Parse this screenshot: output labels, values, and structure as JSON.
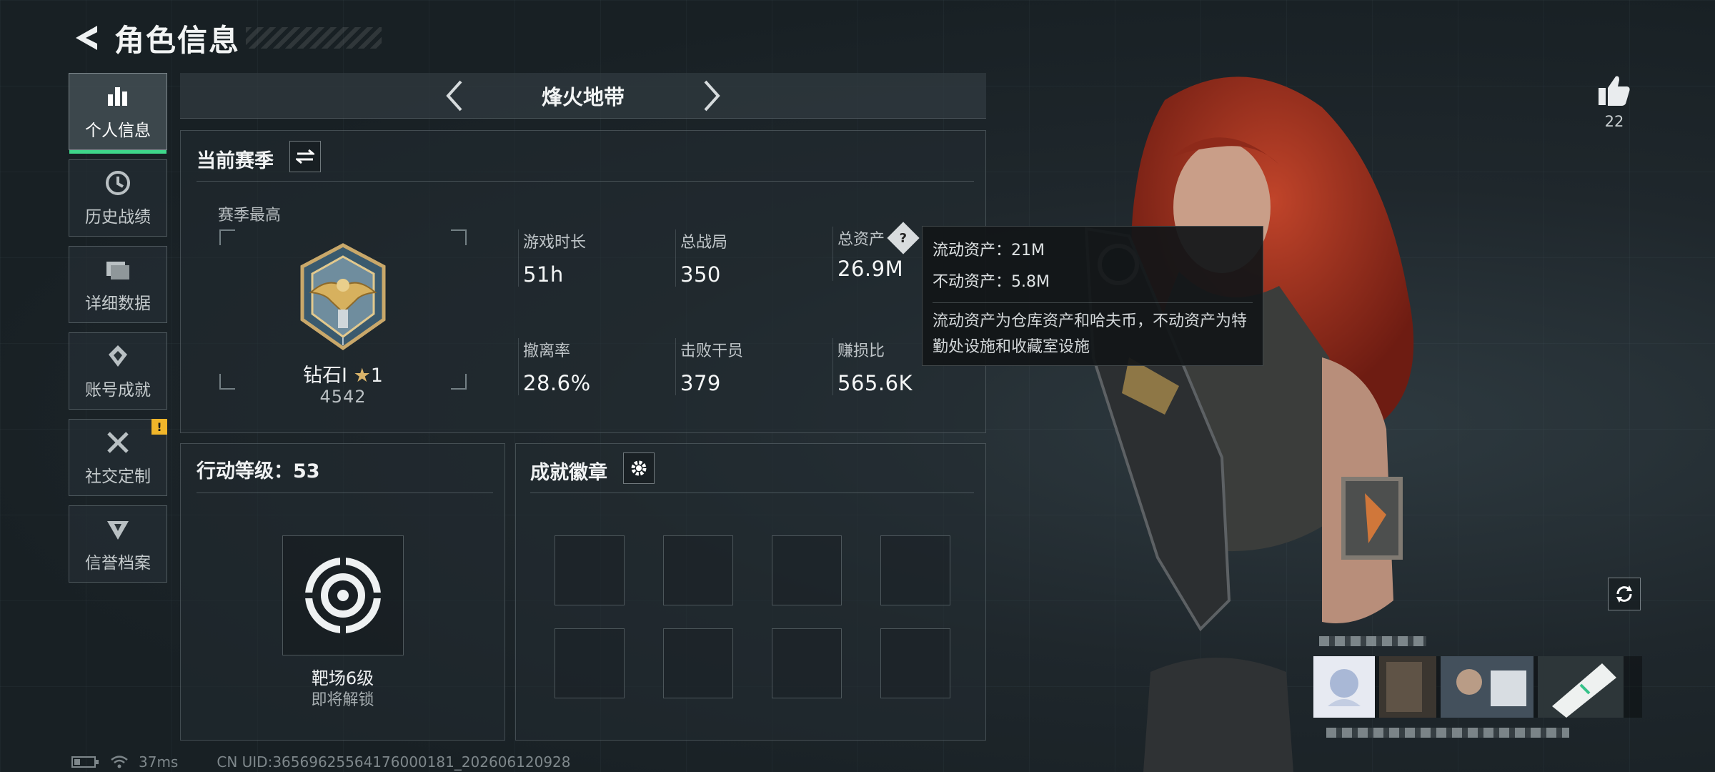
{
  "header": {
    "title": "角色信息"
  },
  "sidebar": {
    "items": [
      {
        "label": "个人信息",
        "icon": "bar-chart-icon"
      },
      {
        "label": "历史战绩",
        "icon": "history-icon"
      },
      {
        "label": "详细数据",
        "icon": "folder-icon"
      },
      {
        "label": "账号成就",
        "icon": "achievement-icon"
      },
      {
        "label": "社交定制",
        "icon": "tools-icon",
        "badge": "!"
      },
      {
        "label": "信誉档案",
        "icon": "shield-icon"
      }
    ]
  },
  "mode": {
    "title": "烽火地带"
  },
  "season": {
    "title": "当前赛季",
    "best_label": "赛季最高",
    "rank_name": "钻石I",
    "rank_stars": "1",
    "rank_points": "4542",
    "stats": [
      {
        "label": "游戏时长",
        "value": "51h"
      },
      {
        "label": "总战局",
        "value": "350"
      },
      {
        "label": "总资产",
        "value": "26.9M"
      },
      {
        "label": "撤离率",
        "value": "28.6%"
      },
      {
        "label": "击败干员",
        "value": "379"
      },
      {
        "label": "赚损比",
        "value": "565.6K"
      }
    ]
  },
  "tooltip": {
    "liquid": "流动资产：21M",
    "fixed": "不动资产：5.8M",
    "desc": "流动资产为仓库资产和哈夫币，不动资产为特勤处设施和收藏室设施"
  },
  "action": {
    "title": "行动等级：53",
    "range_title": "靶场6级",
    "range_sub": "即将解锁"
  },
  "achievements": {
    "title": "成就徽章",
    "slots": 8
  },
  "social": {
    "likes": "22"
  },
  "footer": {
    "ping": "37ms",
    "uid": "CN UID:3656962556417600018​1_202606120928"
  },
  "colors": {
    "accent_green": "#3fd68a",
    "badge_yellow": "#f0b52a",
    "rank_gold": "#d9b36a"
  }
}
